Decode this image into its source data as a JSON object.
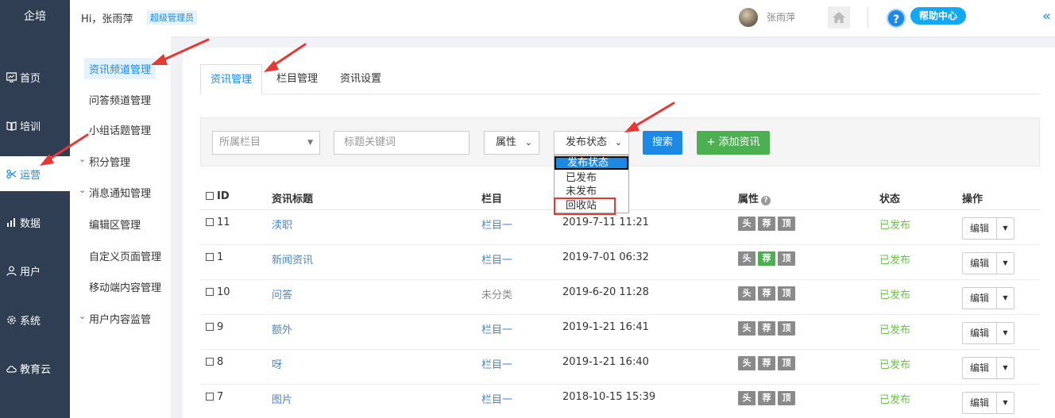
{
  "brand": "企培",
  "header": {
    "greeting": "Hi，张雨萍",
    "role": "超级管理员",
    "username": "张雨萍",
    "help_label": "帮助中心",
    "help_icon_glyph": "?",
    "collapse_glyph": "«"
  },
  "nav": [
    {
      "label": "首页",
      "icon": "dashboard-icon"
    },
    {
      "label": "培训",
      "icon": "book-icon"
    },
    {
      "label": "运营",
      "icon": "scissors-icon"
    },
    {
      "label": "数据",
      "icon": "chart-icon"
    },
    {
      "label": "用户",
      "icon": "user-icon"
    },
    {
      "label": "系统",
      "icon": "gear-icon"
    },
    {
      "label": "教育云",
      "icon": "cloud-icon"
    }
  ],
  "submenu": [
    "资讯频道管理",
    "问答频道管理",
    "小组话题管理",
    "积分管理",
    "消息通知管理",
    "编辑区管理",
    "自定义页面管理",
    "移动端内容管理",
    "用户内容监管"
  ],
  "tabs": [
    "资讯管理",
    "栏目管理",
    "资讯设置"
  ],
  "filter": {
    "category_placeholder": "所属栏目",
    "keyword_placeholder": "标题关键词",
    "attr_label": "属性",
    "status_label": "发布状态",
    "search_label": "搜索",
    "add_label": "添加资讯",
    "add_glyph": "+"
  },
  "status_options": [
    "发布状态",
    "已发布",
    "未发布",
    "回收站"
  ],
  "table": {
    "headers": {
      "id": "ID",
      "title": "资讯标题",
      "category": "栏目",
      "attr": "属性",
      "status": "状态",
      "ops": "操作"
    },
    "rows": [
      {
        "id": "11",
        "title": "渎职",
        "category": "栏目一",
        "date": "2019-7-11 11:21",
        "status": "已发布"
      },
      {
        "id": "1",
        "title": "新闻资讯",
        "category": "栏目一",
        "date": "2019-7-01 06:32",
        "status": "已发布"
      },
      {
        "id": "10",
        "title": "问答",
        "category": "未分类",
        "date": "2019-6-20 11:28",
        "status": "已发布"
      },
      {
        "id": "9",
        "title": "额外",
        "category": "栏目一",
        "date": "2019-1-21 16:41",
        "status": "已发布"
      },
      {
        "id": "8",
        "title": "呀",
        "category": "栏目一",
        "date": "2019-1-21 16:40",
        "status": "已发布"
      },
      {
        "id": "7",
        "title": "图片",
        "category": "栏目一",
        "date": "2018-10-15 15:39",
        "status": "已发布"
      }
    ],
    "tags": [
      "头",
      "荐",
      "顶"
    ],
    "edit_label": "编辑",
    "help_glyph": "?"
  },
  "colors": {
    "accent": "#1e88e5",
    "success": "#4caf50",
    "sidebar": "#2f3e52",
    "annotation": "#e53935"
  }
}
